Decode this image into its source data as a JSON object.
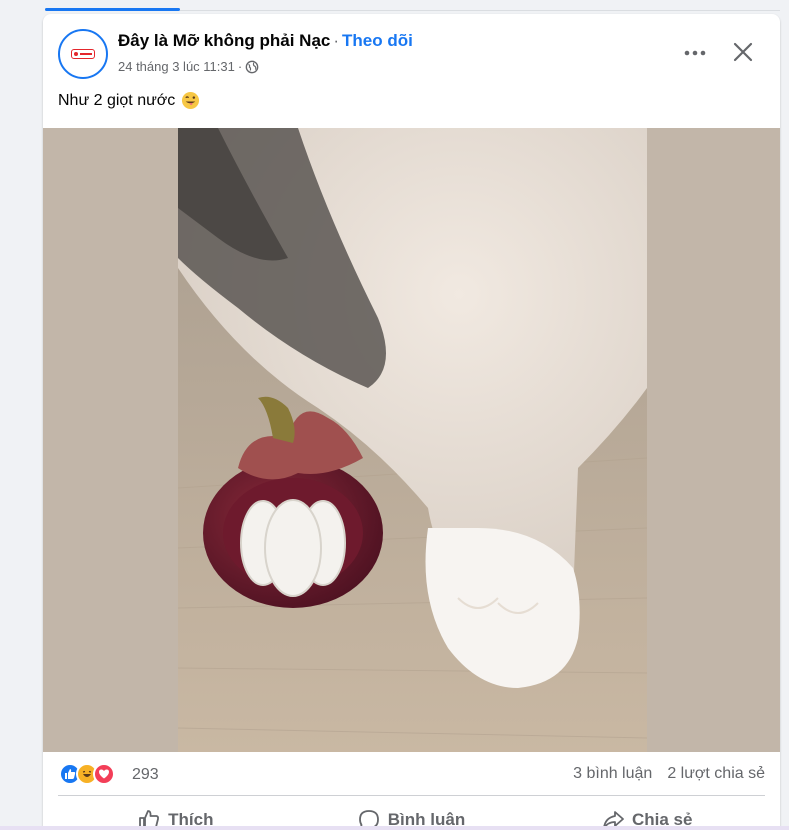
{
  "post": {
    "page_name": "Đây là Mỡ không phải Nạc",
    "separator": "·",
    "follow_label": "Theo dõi",
    "timestamp": "24 tháng 3 lúc 11:31",
    "timestamp_separator": "·",
    "privacy_icon": "globe-icon",
    "caption": "Như 2 giọt nước",
    "caption_emoji": "winking-face-with-tongue-emoji"
  },
  "stats": {
    "reaction_icons": [
      "like-icon",
      "haha-icon",
      "love-icon"
    ],
    "reaction_count": "293",
    "comments": "3 bình luận",
    "shares": "2 lượt chia sẻ"
  },
  "actions": {
    "like_label": "Thích",
    "comment_label": "Bình luận",
    "share_label": "Chia sẻ"
  },
  "colors": {
    "accent": "#1877f2",
    "secondary_text": "#65676b",
    "like": "#1877f2",
    "haha": "#f7b125",
    "love": "#f33e58",
    "media_background": "#c2b6a9"
  }
}
